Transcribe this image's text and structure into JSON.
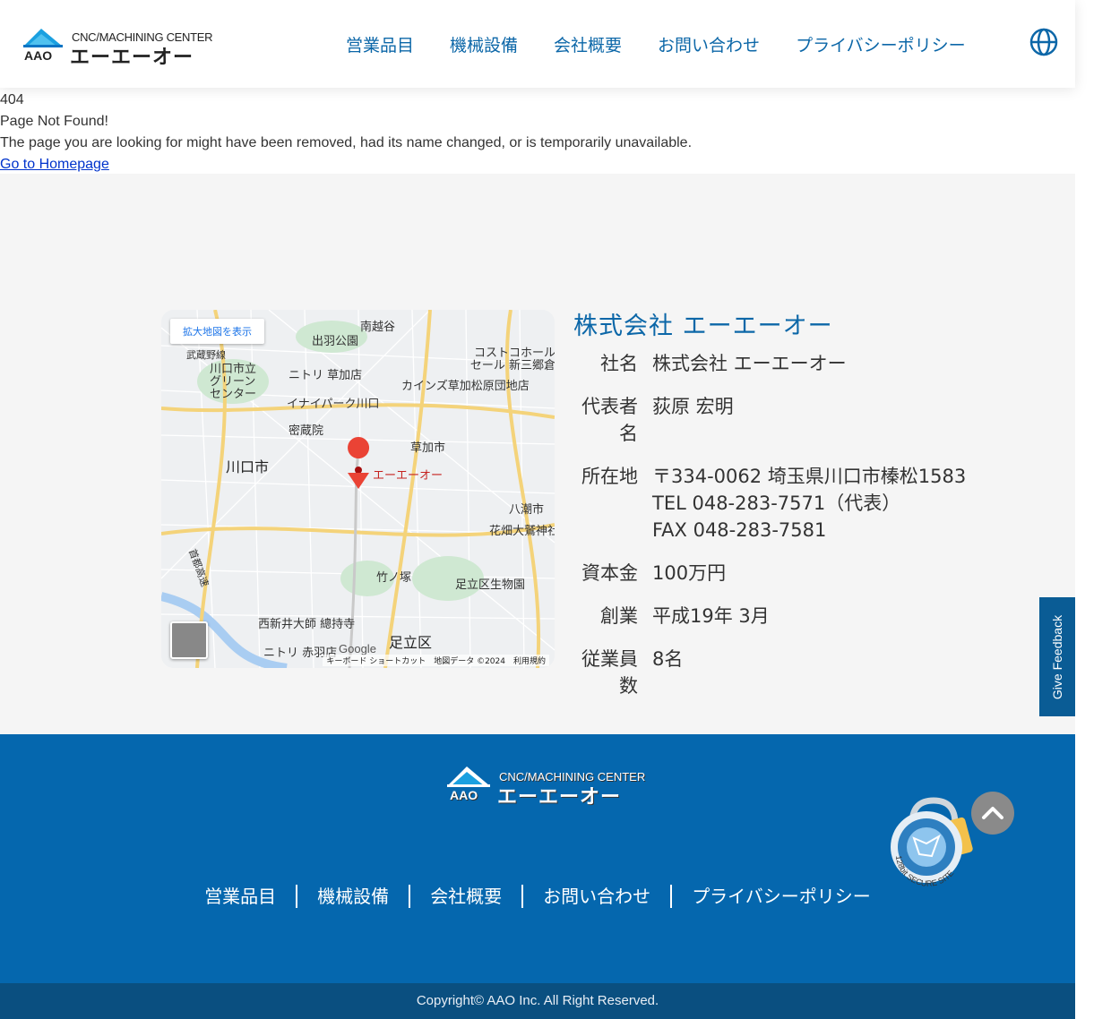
{
  "header": {
    "logo_tagline": "CNC/MACHINING CENTER",
    "logo_brand": "エーエーオー",
    "logo_mark": "AAO",
    "nav": [
      "営業品目",
      "機械設備",
      "会社概要",
      "お問い合わせ",
      "プライバシーポリシー"
    ]
  },
  "error": {
    "code": "404",
    "title": "Page Not Found!",
    "message": "The page you are looking for might have been removed, had its name changed, or is temporarily unavailable.",
    "link": "Go to Homepage"
  },
  "map": {
    "expand_label": "拡大地図を表示",
    "pin_label": "エーエーオー",
    "places": [
      "川口市",
      "草加市",
      "八潮市",
      "足立区",
      "竹ノ塚",
      "出羽公園",
      "南越谷",
      "密蔵院",
      "イナイパーク川口",
      "ニトリ 草加店",
      "カインズ草加松原団地店",
      "コストコホールセール 新三郷倉",
      "足立区生物園",
      "花畑大鷲神社",
      "西新井大師 總持寺",
      "ニトリ 赤羽店",
      "川口市立グリーンセンター",
      "武蔵野線",
      "首都高速"
    ],
    "google": "Google",
    "attribution": "キーボード ショートカット　地図データ ©2024　利用規約"
  },
  "company": {
    "title": "株式会社 エーエーオー",
    "rows": [
      {
        "key": "社名",
        "value": "株式会社 エーエーオー"
      },
      {
        "key": "代表者名",
        "value": "荻原 宏明"
      },
      {
        "key": "所在地",
        "lines": [
          "〒334-0062 埼玉県川口市榛松1583",
          "TEL 048-283-7571（代表）",
          "FAX 048-283-7581"
        ]
      },
      {
        "key": "資本金",
        "value": "100万円"
      },
      {
        "key": "創業",
        "value": "平成19年 3月"
      },
      {
        "key": "従業員数",
        "value": "8名"
      }
    ]
  },
  "feedback": "Give Feedback",
  "footer": {
    "nav": [
      "営業品目",
      "機械設備",
      "会社概要",
      "お問い合わせ",
      "プライバシーポリシー"
    ],
    "secure_label": "128bit SECURE SITE",
    "copyright": "Copyright© AAO Inc. All Right Reserved."
  },
  "colors": {
    "brand_blue": "#0567ae",
    "link_blue": "#0c67a8",
    "copyright_bar": "#0a4f80"
  }
}
